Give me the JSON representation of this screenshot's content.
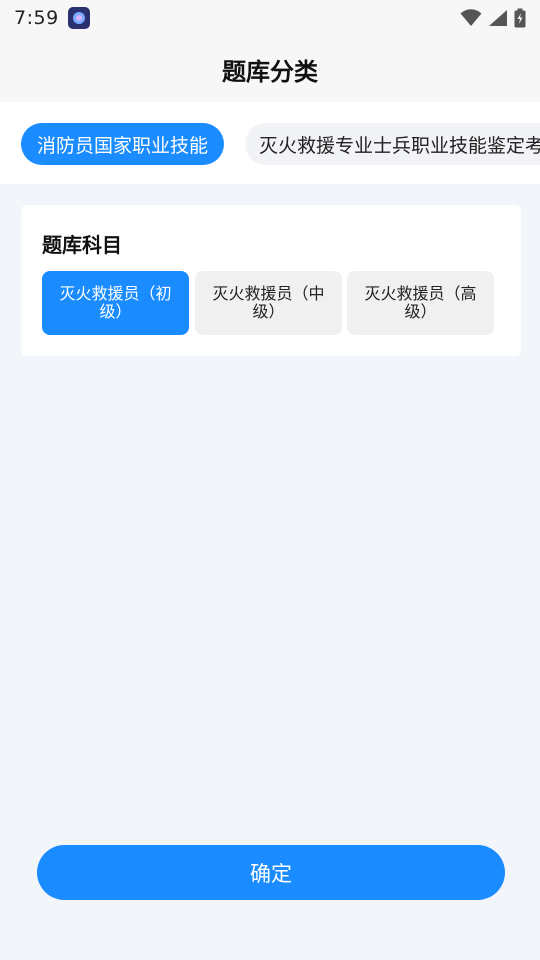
{
  "status_bar": {
    "time": "7:59"
  },
  "header": {
    "title": "题库分类"
  },
  "categories": [
    {
      "label": "消防员国家职业技能",
      "active": true
    },
    {
      "label": "灭火救援专业士兵职业技能鉴定考",
      "active": false
    }
  ],
  "subject_card": {
    "title": "题库科目",
    "options": [
      {
        "label": "灭火救援员（初级）",
        "selected": true
      },
      {
        "label": "灭火救援员（中级）",
        "selected": false
      },
      {
        "label": "灭火救援员（高级）",
        "selected": false
      }
    ]
  },
  "footer": {
    "confirm_label": "确定"
  },
  "colors": {
    "accent": "#1a8cff",
    "background": "#f2f6fa"
  }
}
